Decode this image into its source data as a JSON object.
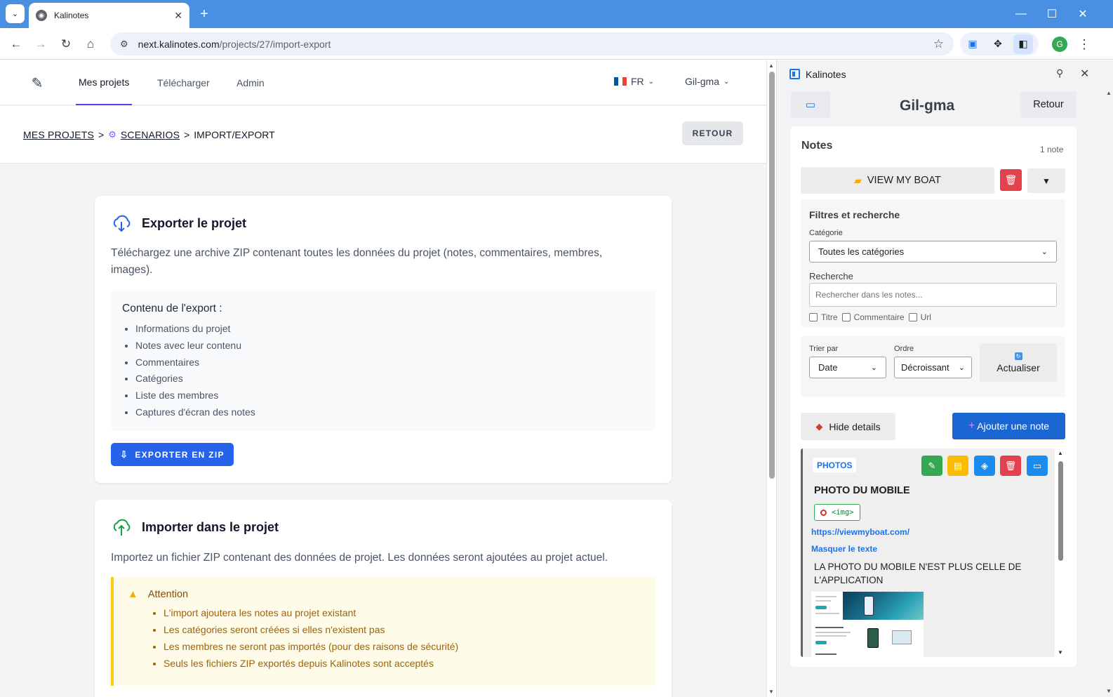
{
  "browser": {
    "tab_title": "Kalinotes",
    "tab_favicon": "globe-icon",
    "url_host": "next.kalinotes.com",
    "url_path": "/projects/27/import-export"
  },
  "nav": {
    "links": [
      "Mes projets",
      "Télécharger",
      "Admin"
    ],
    "language": "FR",
    "user": "Gil-gma"
  },
  "header": {
    "crumb_projects": "MES PROJETS",
    "crumb_scenarios": "SCENARIOS",
    "crumb_current": "IMPORT/EXPORT",
    "back_label": "RETOUR"
  },
  "export": {
    "title": "Exporter le projet",
    "description": "Téléchargez une archive ZIP contenant toutes les données du projet (notes, commentaires, membres, images).",
    "contents_title": "Contenu de l'export :",
    "items": [
      "Informations du projet",
      "Notes avec leur contenu",
      "Commentaires",
      "Catégories",
      "Liste des membres",
      "Captures d'écran des notes"
    ],
    "button_label": "EXPORTER EN ZIP"
  },
  "import": {
    "title": "Importer dans le projet",
    "description": "Importez un fichier ZIP contenant des données de projet. Les données seront ajoutées au projet actuel.",
    "warning_title": "Attention",
    "warning_items": [
      "L'import ajoutera les notes au projet existant",
      "Les catégories seront créées si elles n'existent pas",
      "Les membres ne seront pas importés (pour des raisons de sécurité)",
      "Seuls les fichiers ZIP exportés depuis Kalinotes sont acceptés"
    ]
  },
  "sidepanel": {
    "title": "Kalinotes",
    "username": "Gil-gma",
    "retour_label": "Retour",
    "notes_heading": "Notes",
    "notes_count": "1 note",
    "folder_label": "VIEW MY BOAT",
    "folder_toggle": "▼",
    "filters_title": "Filtres et recherche",
    "category_label": "Catégorie",
    "category_value": "Toutes les catégories",
    "search_label": "Recherche",
    "search_placeholder": "Rechercher dans les notes...",
    "search_options": [
      "Titre",
      "Commentaire",
      "Url"
    ],
    "sort_label": "Trier par",
    "sort_value": "Date",
    "order_label": "Ordre",
    "order_value": "Décroissant",
    "refresh_label": "Actualiser",
    "hide_details_label": "Hide details",
    "add_note_label": "Ajouter une note",
    "note": {
      "category": "PHOTOS",
      "title": "PHOTO DU MOBILE",
      "tag": "<img>",
      "url": "https://viewmyboat.com/",
      "toggle_text": "Masquer le texte",
      "body": "LA PHOTO DU MOBILE N'EST PLUS CELLE DE L'APPLICATION"
    }
  },
  "colors": {
    "tabbar": "#4a90e2",
    "primary_button": "#2563eb",
    "add_note": "#1a66d2",
    "danger": "#e3414d",
    "warning_bg": "#fefce8",
    "warning_border": "#facc15"
  },
  "icons": {
    "note_actions": [
      "pencil-icon",
      "clipboard-icon",
      "tag-icon",
      "trash-icon",
      "window-icon"
    ]
  }
}
